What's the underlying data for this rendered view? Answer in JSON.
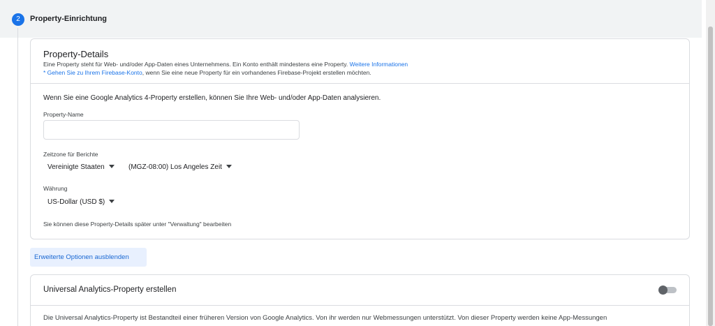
{
  "step": {
    "number": "2",
    "title": "Property-Einrichtung"
  },
  "details": {
    "title": "Property-Details",
    "sub1_text": "Eine Property steht für Web- und/oder App-Daten eines Unternehmens. Ein Konto enthält mindestens eine Property.",
    "sub1_link": "Weitere Informationen",
    "sub2_link": "* Gehen Sie zu Ihrem Firebase-Konto",
    "sub2_text": ", wenn Sie eine neue Property für ein vorhandenes Firebase-Projekt erstellen möchten.",
    "intro": "Wenn Sie eine Google Analytics 4-Property erstellen, können Sie Ihre Web- und/oder App-Daten analysieren.",
    "property_name_label": "Property-Name",
    "property_name_value": "",
    "timezone_label": "Zeitzone für Berichte",
    "country_value": "Vereinigte Staaten",
    "timezone_value": "(MGZ-08:00) Los Angeles Zeit",
    "currency_label": "Währung",
    "currency_value": "US-Dollar (USD $)",
    "hint": "Sie können diese Property-Details später unter \"Verwaltung\" bearbeiten"
  },
  "advanced_button": "Erweiterte Optionen ausblenden",
  "universal": {
    "title": "Universal Analytics-Property erstellen",
    "toggle_on": false,
    "description": "Die Universal Analytics-Property ist Bestandteil einer früheren Version von Google Analytics. Von ihr werden nur Webmessungen unterstützt. Von dieser Property werden keine App-Messungen"
  },
  "colors": {
    "accent": "#1a73e8",
    "header_bg": "#f1f3f4",
    "button_bg": "#e8f0fe",
    "border": "#dadce0"
  }
}
